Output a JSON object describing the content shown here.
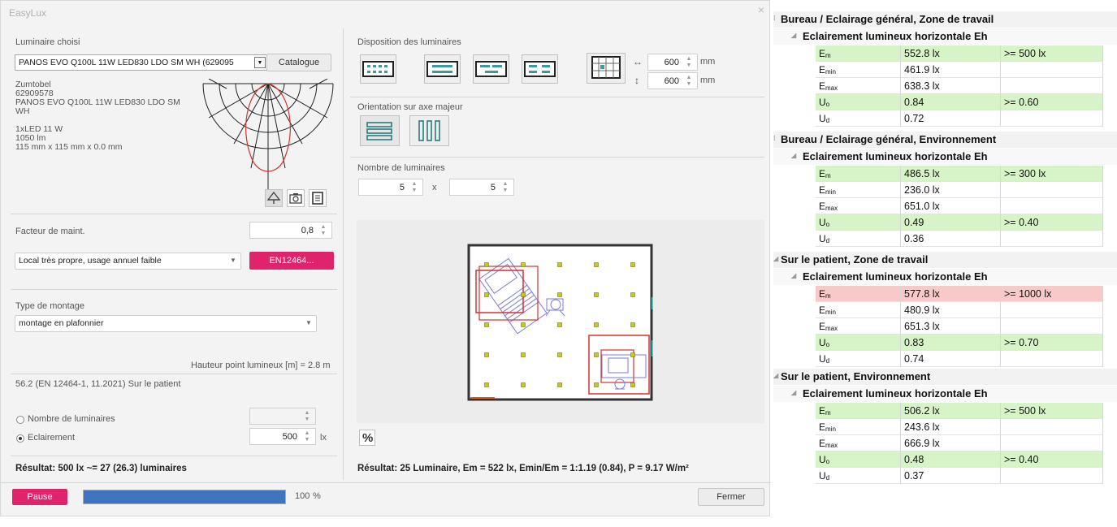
{
  "window": {
    "title": "EasyLux",
    "close": "×"
  },
  "luminaire": {
    "section_label": "Luminaire choisi",
    "selected": "PANOS EVO Q100L 11W LED830 LDO SM WH (629095",
    "catalogue_button": "Catalogue",
    "manufacturer": "Zumtobel",
    "article": "62909578",
    "name_line1": "PANOS EVO Q100L 11W LED830 LDO SM",
    "name_line2": "WH",
    "lamp": "1xLED 11 W",
    "flux": "1050 lm",
    "dimensions": "115 mm x 115 mm x 0.0 mm"
  },
  "maintenance": {
    "label": "Facteur de maint.",
    "value": "0,8",
    "condition": "Local très propre, usage annuel faible",
    "standard_button": "EN12464..."
  },
  "mounting": {
    "label": "Type de montage",
    "value": "montage en plafonnier",
    "height_label": "Hauteur point lumineux [m] = 2.8 m",
    "requirement": "56.2 (EN 12464-1, 11.2021) Sur le patient"
  },
  "calc_mode": {
    "option_count": "Nombre de luminaires",
    "option_illuminance": "Eclairement",
    "illuminance_value": "500",
    "unit": "lx",
    "selected": "Eclairement"
  },
  "result_left": "Résultat: 500 lx ~= 27 (26.3) luminaires",
  "progress": {
    "button": "Pause",
    "percent": 100,
    "percent_label": "100",
    "percent_unit": "%"
  },
  "layout": {
    "label": "Disposition des luminaires",
    "spacing_x": "600",
    "spacing_y": "600",
    "unit": "mm",
    "orientation_label": "Orientation sur axe majeur",
    "count_label": "Nombre de luminaires",
    "count_x": "5",
    "times": "x",
    "count_y": "5",
    "percent_button": "%"
  },
  "result_right": "Résultat: 25 Luminaire, Em = 522 lx, Emin/Em = 1:1.19 (0.84), P = 9.17 W/m²",
  "close_button": "Fermer",
  "colors": {
    "accent": "#e0246b",
    "progress": "#3e74c0",
    "pass": "#d7f3c8",
    "fail": "#f7c9c9"
  },
  "results": [
    {
      "title": "Bureau / Eclairage général, Zone de travail",
      "subtitle": "Eclairement lumineux horizontale Eh",
      "rows": [
        {
          "sym": "E",
          "sub": "m",
          "value": "552.8 lx",
          "req": ">= 500 lx",
          "status": "pass"
        },
        {
          "sym": "E",
          "sub": "min",
          "value": "461.9 lx",
          "req": "",
          "status": ""
        },
        {
          "sym": "E",
          "sub": "max",
          "value": "638.3 lx",
          "req": "",
          "status": ""
        },
        {
          "sym": "U",
          "sub": "o",
          "value": "0.84",
          "req": ">= 0.60",
          "status": "pass"
        },
        {
          "sym": "U",
          "sub": "d",
          "value": "0.72",
          "req": "",
          "status": ""
        }
      ]
    },
    {
      "title": "Bureau / Eclairage général, Environnement",
      "subtitle": "Eclairement lumineux horizontale Eh",
      "rows": [
        {
          "sym": "E",
          "sub": "m",
          "value": "486.5 lx",
          "req": ">= 300 lx",
          "status": "pass"
        },
        {
          "sym": "E",
          "sub": "min",
          "value": "236.0 lx",
          "req": "",
          "status": ""
        },
        {
          "sym": "E",
          "sub": "max",
          "value": "651.0 lx",
          "req": "",
          "status": ""
        },
        {
          "sym": "U",
          "sub": "o",
          "value": "0.49",
          "req": ">= 0.40",
          "status": "pass"
        },
        {
          "sym": "U",
          "sub": "d",
          "value": "0.36",
          "req": "",
          "status": ""
        }
      ]
    },
    {
      "title": "Sur le patient, Zone de travail",
      "subtitle": "Eclairement lumineux horizontale Eh",
      "rows": [
        {
          "sym": "E",
          "sub": "m",
          "value": "577.8 lx",
          "req": ">= 1000 lx",
          "status": "fail"
        },
        {
          "sym": "E",
          "sub": "min",
          "value": "480.9 lx",
          "req": "",
          "status": ""
        },
        {
          "sym": "E",
          "sub": "max",
          "value": "651.3 lx",
          "req": "",
          "status": ""
        },
        {
          "sym": "U",
          "sub": "o",
          "value": "0.83",
          "req": ">= 0.70",
          "status": "pass"
        },
        {
          "sym": "U",
          "sub": "d",
          "value": "0.74",
          "req": "",
          "status": ""
        }
      ]
    },
    {
      "title": "Sur le patient, Environnement",
      "subtitle": "Eclairement lumineux horizontale Eh",
      "rows": [
        {
          "sym": "E",
          "sub": "m",
          "value": "506.2 lx",
          "req": ">= 500 lx",
          "status": "pass"
        },
        {
          "sym": "E",
          "sub": "min",
          "value": "243.6 lx",
          "req": "",
          "status": ""
        },
        {
          "sym": "E",
          "sub": "max",
          "value": "666.9 lx",
          "req": "",
          "status": ""
        },
        {
          "sym": "U",
          "sub": "o",
          "value": "0.48",
          "req": ">= 0.40",
          "status": "pass"
        },
        {
          "sym": "U",
          "sub": "d",
          "value": "0.37",
          "req": "",
          "status": ""
        }
      ]
    }
  ]
}
